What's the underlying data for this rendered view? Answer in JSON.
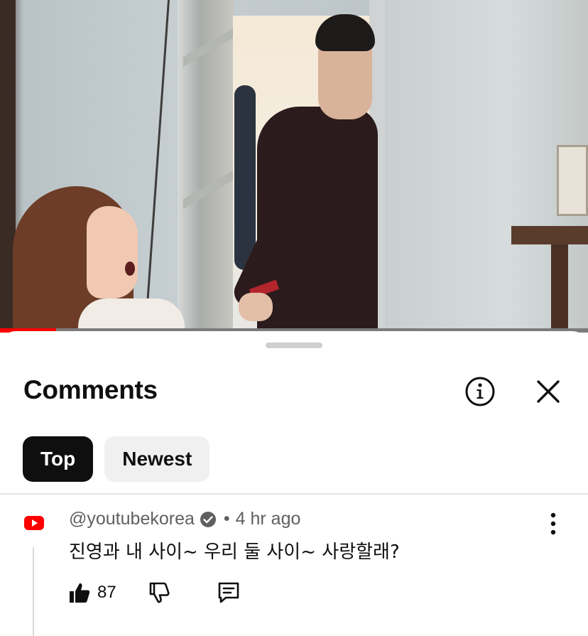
{
  "video": {
    "progress_fraction": 0.095
  },
  "comments_panel": {
    "title": "Comments",
    "info_icon": "info-circle-icon",
    "close_icon": "close-icon",
    "sort_chips": [
      {
        "label": "Top",
        "selected": true
      },
      {
        "label": "Newest",
        "selected": false
      }
    ]
  },
  "comment": {
    "author": "@youtubekorea",
    "verified": true,
    "separator": "•",
    "time": "4 hr ago",
    "text": "진영과 내 사이~ 우리 둘 사이~ 사랑할래?",
    "like_count": "87",
    "avatar_icon": "youtube-logo-icon"
  },
  "colors": {
    "accent": "#ff0000",
    "text_primary": "#0f0f0f",
    "text_secondary": "#606060",
    "chip_bg": "#f0f0f0",
    "chip_active_bg": "#0f0f0f"
  }
}
